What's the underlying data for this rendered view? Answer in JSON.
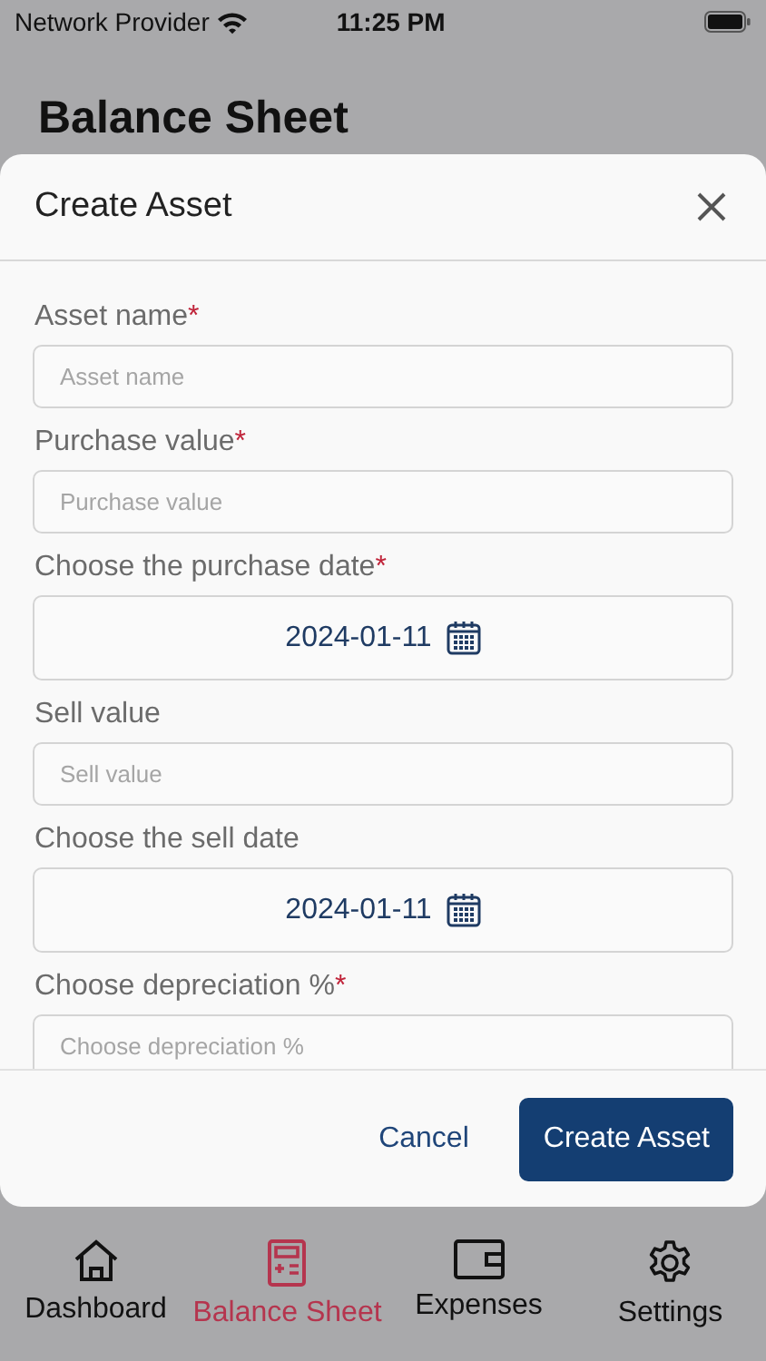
{
  "status_bar": {
    "carrier": "Network Provider",
    "time": "11:25 PM"
  },
  "page_title": "Balance Sheet",
  "required_mark": "*",
  "modal": {
    "title": "Create Asset",
    "fields": [
      {
        "kind": "text",
        "label": "Asset name",
        "required": true,
        "placeholder": "Asset name"
      },
      {
        "kind": "text",
        "label": "Purchase value",
        "required": true,
        "placeholder": "Purchase value"
      },
      {
        "kind": "date",
        "label": "Choose the purchase date",
        "required": true,
        "value": "2024-01-11"
      },
      {
        "kind": "text",
        "label": "Sell value",
        "required": false,
        "placeholder": "Sell value"
      },
      {
        "kind": "date",
        "label": "Choose the sell date",
        "required": false,
        "value": "2024-01-11"
      },
      {
        "kind": "text",
        "label": "Choose depreciation %",
        "required": true,
        "placeholder": "Choose depreciation %"
      }
    ],
    "cancel": "Cancel",
    "submit": "Create Asset"
  },
  "tab_bar": [
    {
      "kind": "home",
      "label": "Dashboard",
      "selected": false
    },
    {
      "kind": "calculator",
      "label": "Balance Sheet",
      "selected": true
    },
    {
      "kind": "wallet",
      "label": "Expenses",
      "selected": false
    },
    {
      "kind": "gear",
      "label": "Settings",
      "selected": false
    }
  ]
}
